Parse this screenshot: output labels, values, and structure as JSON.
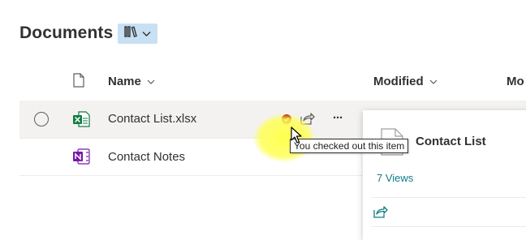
{
  "library": {
    "title": "Documents",
    "view_icon": "library-view-icon"
  },
  "columns": {
    "file_type_icon": "document-icon",
    "name": "Name",
    "modified": "Modified",
    "modified_by": "Mo"
  },
  "files": [
    {
      "name": "Contact List.xlsx",
      "type_icon": "excel-file-icon",
      "selected": true
    },
    {
      "name": "Contact Notes",
      "type_icon": "onenote-file-icon",
      "selected": false
    }
  ],
  "row_actions": {
    "checked_out_icon": "checked-out-icon",
    "share_icon": "share-icon",
    "more_label": "···"
  },
  "tooltip": {
    "text": "You checked out this item"
  },
  "details_card": {
    "title": "Contact List",
    "views": "7 Views",
    "share_icon": "share-icon"
  },
  "colors": {
    "view_button_bg": "#c7e0f4",
    "excel_green": "#107c41",
    "onenote_purple": "#7719aa",
    "checked_out_red": "#a80000",
    "link_teal": "#107c83",
    "cursor_highlight": "#ffff5a"
  }
}
